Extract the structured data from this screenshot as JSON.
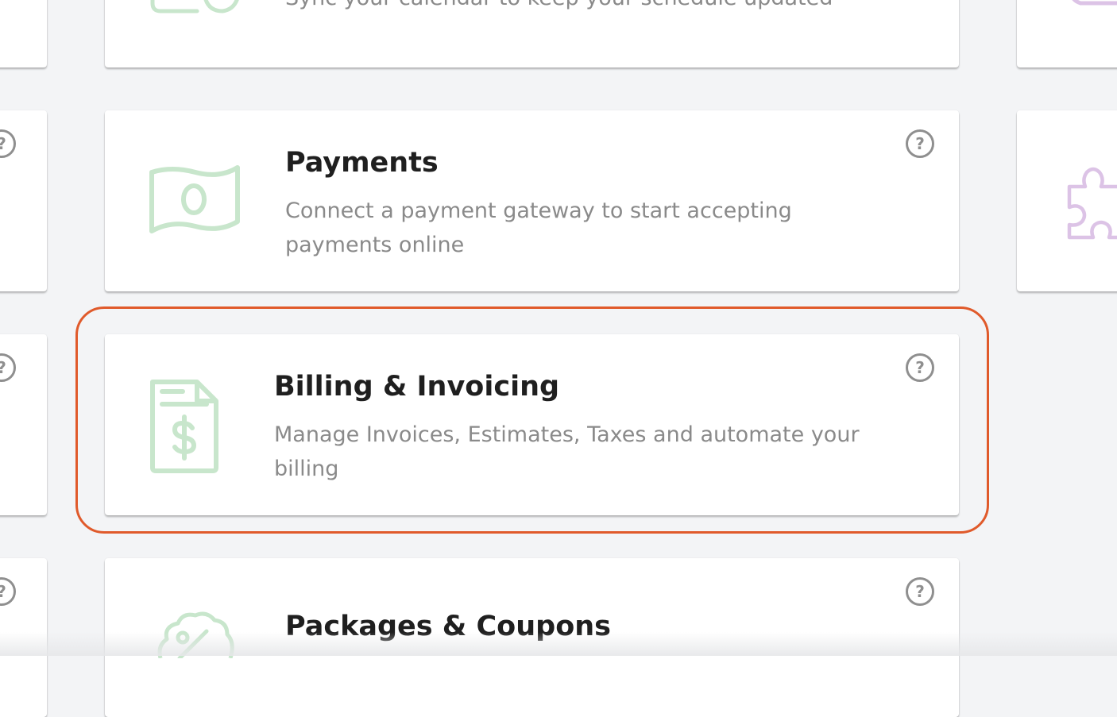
{
  "cards": {
    "calendar": {
      "description": "Sync your calendar to keep your schedule updated",
      "icon": "calendar-icon"
    },
    "payments": {
      "title": "Payments",
      "description": "Connect a payment gateway to start accepting payments online",
      "icon": "money-icon"
    },
    "billing": {
      "title": "Billing & Invoicing",
      "description": "Manage Invoices, Estimates, Taxes and automate your billing",
      "icon": "invoice-icon"
    },
    "packages": {
      "title": "Packages & Coupons",
      "icon": "discount-badge-icon"
    }
  },
  "help": {
    "glyph": "?"
  },
  "colors": {
    "icon_green": "#c8e6cc",
    "icon_purple": "#dcc3e6",
    "highlight_orange": "#e05a2b",
    "page_background": "#f3f4f6"
  }
}
